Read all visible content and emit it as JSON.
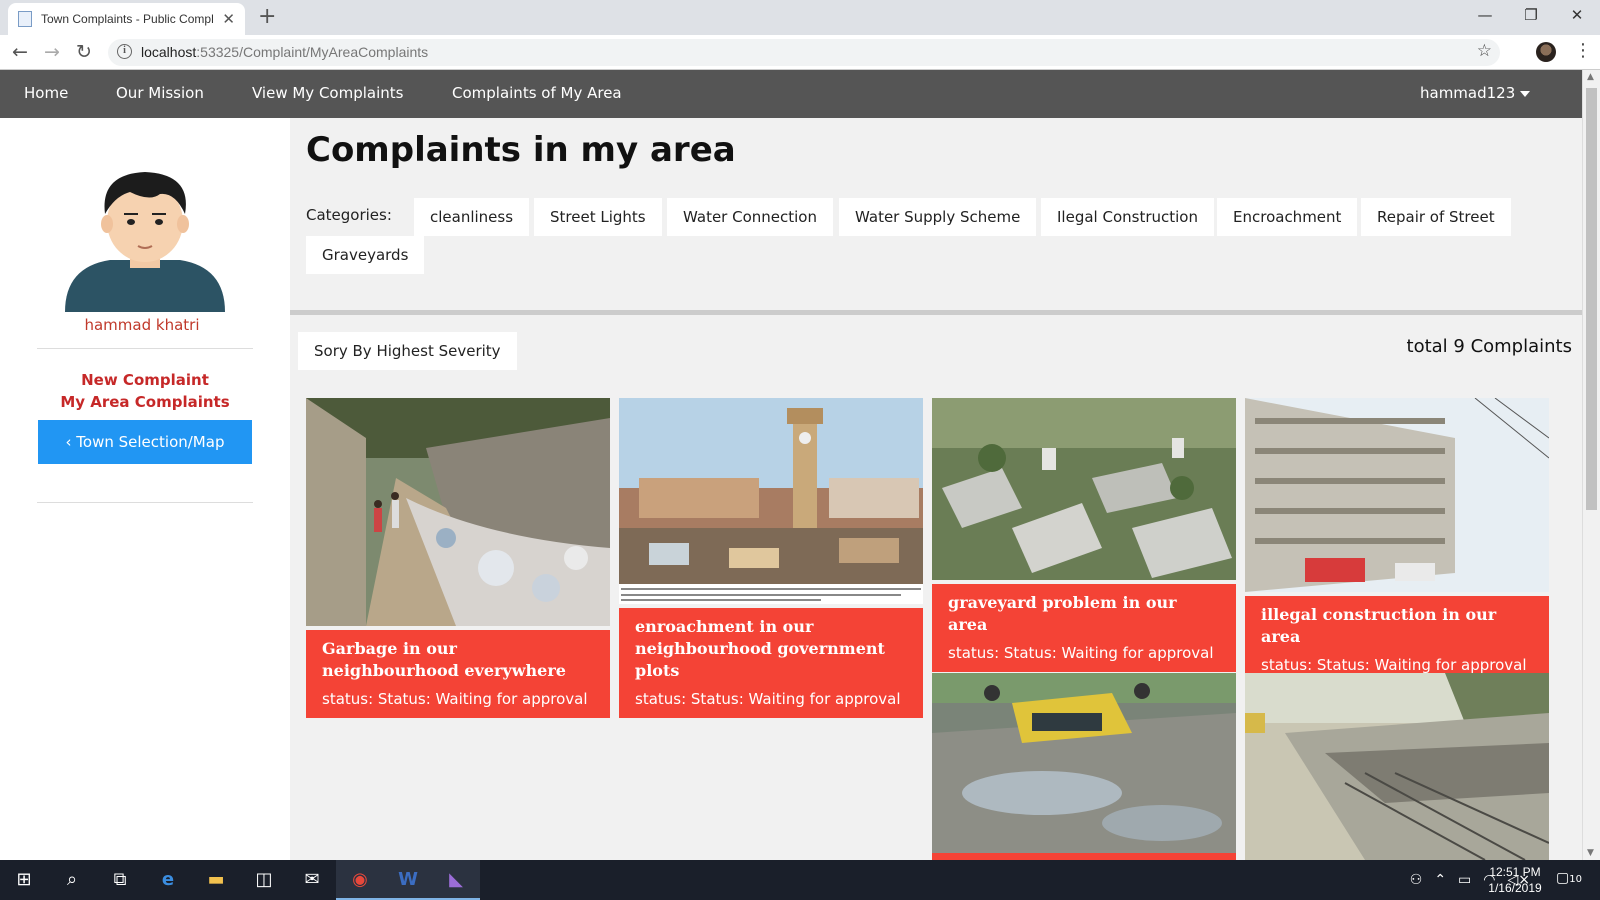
{
  "browser": {
    "tab_title": "Town Complaints - Public Compl",
    "tab_close": "✕",
    "new_tab": "+",
    "url_host": "localhost",
    "url_path": ":53325/Complaint/MyAreaComplaints",
    "window_controls": [
      "—",
      "❐",
      "✕"
    ]
  },
  "nav": {
    "links": [
      "Home",
      "Our Mission",
      "View My Complaints",
      "Complaints of My Area"
    ],
    "user": "hammad123"
  },
  "sidebar": {
    "user_name": "hammad khatri",
    "links": [
      "New Complaint",
      "My Area Complaints"
    ],
    "map_button": "Town Selection/Map",
    "map_icon": "‹"
  },
  "main": {
    "title": "Complaints in my area",
    "categories_label": "Categories:",
    "categories": [
      "cleanliness",
      "Street Lights",
      "Water Connection",
      "Water Supply Scheme",
      "Ilegal Construction",
      "Encroachment",
      "Repair of Street",
      "Graveyards"
    ],
    "sort_button": "Sory By Highest Severity",
    "total": "total 9 Complaints"
  },
  "cards": [
    {
      "title": "Garbage in our neighbourhood everywhere",
      "status": "status: Status: Waiting for approval"
    },
    {
      "title": "enroachment in our neighbourhood government plots",
      "status": "status: Status: Waiting for approval"
    },
    {
      "title": "graveyard problem in our area",
      "status": "status: Status: Waiting for approval"
    },
    {
      "title": "illegal construction in our area",
      "status": "status: Status: Waiting for approval"
    }
  ],
  "taskbar": {
    "time": "12:51 PM",
    "date": "1/16/2019",
    "notifications": "10"
  },
  "colors": {
    "nav_bg": "#555555",
    "card_accent": "#f44336",
    "button_blue": "#2196f3",
    "link_red": "#c62828"
  }
}
